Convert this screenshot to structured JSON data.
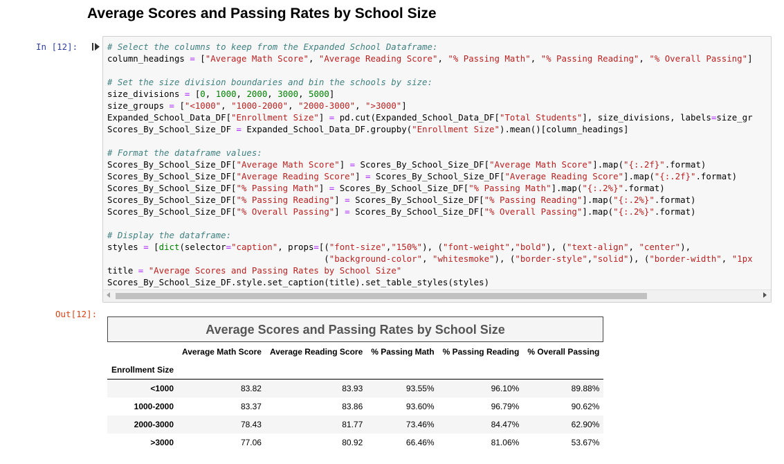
{
  "page_heading": "Average Scores and Passing Rates by School Size",
  "cell": {
    "in_prompt": "In [12]:",
    "out_prompt": "Out[12]:",
    "code_lines": [
      "# Select the columns to keep from the Expanded School Dataframe:",
      "column_headings = [\"Average Math Score\", \"Average Reading Score\", \"% Passing Math\", \"% Passing Reading\", \"% Overall Passing\"]",
      "",
      "# Set the size division boundaries and bin the schools by size:",
      "size_divisions = [0, 1000, 2000, 3000, 5000]",
      "size_groups = [\"<1000\", \"1000-2000\", \"2000-3000\", \">3000\"]",
      "Expanded_School_Data_DF[\"Enrollment Size\"] = pd.cut(Expanded_School_Data_DF[\"Total Students\"], size_divisions, labels=size_gr",
      "Scores_By_School_Size_DF = Expanded_School_Data_DF.groupby(\"Enrollment Size\").mean()[column_headings]",
      "",
      "# Format the dataframe values:",
      "Scores_By_School_Size_DF[\"Average Math Score\"] = Scores_By_School_Size_DF[\"Average Math Score\"].map(\"{:.2f}\".format)",
      "Scores_By_School_Size_DF[\"Average Reading Score\"] = Scores_By_School_Size_DF[\"Average Reading Score\"].map(\"{:.2f}\".format)",
      "Scores_By_School_Size_DF[\"% Passing Math\"] = Scores_By_School_Size_DF[\"% Passing Math\"].map(\"{:.2%}\".format)",
      "Scores_By_School_Size_DF[\"% Passing Reading\"] = Scores_By_School_Size_DF[\"% Passing Reading\"].map(\"{:.2%}\".format)",
      "Scores_By_School_Size_DF[\"% Overall Passing\"] = Scores_By_School_Size_DF[\"% Overall Passing\"].map(\"{:.2%}\".format)",
      "",
      "# Display the dataframe:",
      "styles = [dict(selector=\"caption\", props=[(\"font-size\",\"150%\"), (\"font-weight\",\"bold\"), (\"text-align\", \"center\"),",
      "                                          (\"background-color\", \"whitesmoke\"), (\"border-style\",\"solid\"), (\"border-width\", \"1px",
      "title = \"Average Scores and Passing Rates by School Size\"",
      "Scores_By_School_Size_DF.style.set_caption(title).set_table_styles(styles)"
    ],
    "scrollbar_position": 0.0
  },
  "output": {
    "caption": "Average Scores and Passing Rates by School Size",
    "index_name": "Enrollment Size",
    "columns": [
      "Average Math Score",
      "Average Reading Score",
      "% Passing Math",
      "% Passing Reading",
      "% Overall Passing"
    ],
    "rows": [
      {
        "index": "<1000",
        "values": [
          "83.82",
          "83.93",
          "93.55%",
          "96.10%",
          "89.88%"
        ]
      },
      {
        "index": "1000-2000",
        "values": [
          "83.37",
          "83.86",
          "93.60%",
          "96.79%",
          "90.62%"
        ]
      },
      {
        "index": "2000-3000",
        "values": [
          "78.43",
          "81.77",
          "73.46%",
          "84.47%",
          "62.90%"
        ]
      },
      {
        "index": ">3000",
        "values": [
          "77.06",
          "80.92",
          "66.46%",
          "81.06%",
          "53.67%"
        ]
      }
    ]
  },
  "icons": {
    "run": "run-cell-icon"
  },
  "colors": {
    "in_prompt": "#303F9F",
    "out_prompt": "#D84315",
    "comment": "#408080",
    "string": "#BA2121",
    "number": "#008000",
    "operator": "#AA22FF"
  }
}
